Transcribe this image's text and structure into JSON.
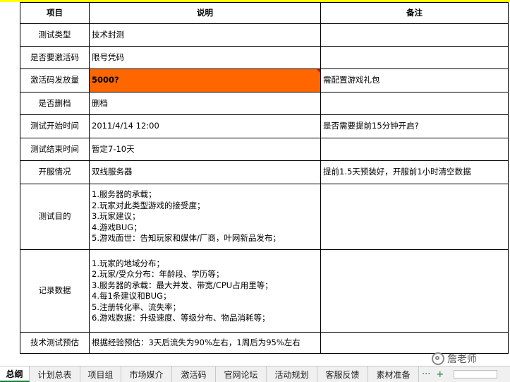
{
  "table": {
    "headers": {
      "item": "项目",
      "desc": "说明",
      "note": "备注"
    },
    "rows": [
      {
        "item": "测试类型",
        "desc": [
          "技术封测"
        ],
        "note": ""
      },
      {
        "item": "是否要激活码",
        "desc": [
          "限号凭码"
        ],
        "note": ""
      },
      {
        "item": "激活码发放量",
        "desc": [
          "5000?"
        ],
        "note": "需配置游戏礼包"
      },
      {
        "item": "是否删档",
        "desc": [
          "删档"
        ],
        "note": ""
      },
      {
        "item": "测试开始时间",
        "desc": [
          "2011/4/14 12:00"
        ],
        "note": "是否需要提前15分钟开启?"
      },
      {
        "item": "测试结束时间",
        "desc": [
          "暂定7-10天"
        ],
        "note": ""
      },
      {
        "item": "开服情况",
        "desc": [
          "双线服务器"
        ],
        "note": "提前1.5天预装好，开服前1小时清空数据"
      },
      {
        "item": "测试目的",
        "desc": [
          "1.服务器的承载；",
          "2.玩家对此类型游戏的接受度；",
          "3.玩家建议；",
          "4.游戏BUG；",
          "5.游戏面世：告知玩家和媒体/厂商，叶网新品发布；"
        ],
        "note": ""
      },
      {
        "item": "记录数据",
        "desc": [
          "1.玩家的地域分布；",
          "2.玩家/受众分布：年龄段、学历等；",
          "3.服务器的承载：最大并发、带宽/CPU占用里等；",
          "4.每1条建议和BUG；",
          "5.注册转化率、流失率；",
          "6.游戏数据：升级速度、等级分布、物品消耗等；"
        ],
        "note": ""
      },
      {
        "item": "技术测试预估",
        "desc": [
          "根据经验预估：3天后流失为90%左右，1周后为95%左右"
        ],
        "note": ""
      }
    ]
  },
  "highlight": {
    "row_index": 2,
    "fill_color": "#ff6600",
    "comment_marker_color": "#e00000"
  },
  "watermark": {
    "text": "詹老师",
    "icon": "wechat-logo-icon"
  },
  "sheet_tabs": {
    "items": [
      {
        "label": "总纲",
        "active": true
      },
      {
        "label": "计划总表",
        "active": false
      },
      {
        "label": "项目组",
        "active": false
      },
      {
        "label": "市场媒介",
        "active": false
      },
      {
        "label": "激活码",
        "active": false
      },
      {
        "label": "官网论坛",
        "active": false
      },
      {
        "label": "活动规划",
        "active": false
      },
      {
        "label": "客服反馈",
        "active": false
      },
      {
        "label": "素材准备",
        "active": false
      }
    ],
    "more_label": "···",
    "add_label": "+",
    "accent_color": "#1a7f37"
  }
}
